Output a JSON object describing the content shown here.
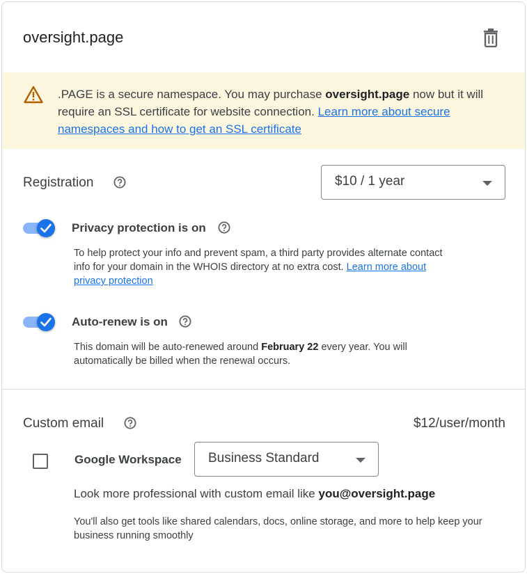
{
  "header": {
    "domain": "oversight.page",
    "delete_icon": "trash-icon"
  },
  "warning": {
    "icon": "warning-icon",
    "text_pre": ".PAGE is a secure namespace. You may purchase ",
    "domain_bold": "oversight.page",
    "text_post": " now but it will require an SSL certificate for website connection. ",
    "link": "Learn more about secure namespaces and how to get an SSL certificate"
  },
  "registration": {
    "title": "Registration",
    "help_icon": "help-icon",
    "select_value": "$10 / 1 year"
  },
  "privacy": {
    "state": "on",
    "label": "Privacy protection is on",
    "desc": "To help protect your info and prevent spam, a third party provides alternate contact info for your domain in the WHOIS directory at no extra cost. ",
    "link": "Learn more about privacy protection"
  },
  "autorenew": {
    "state": "on",
    "label": "Auto-renew is on",
    "desc_pre": "This domain will be auto-renewed around ",
    "date": "February 22",
    "desc_post": " every year. You will automatically be billed when the renewal occurs."
  },
  "custom_email": {
    "title": "Custom email",
    "help_icon": "help-icon",
    "price": "$12/user/month",
    "checkbox_checked": false,
    "workspace_label": "Google Workspace",
    "plan_value": "Business Standard",
    "promo_pre": "Look more professional with custom email like ",
    "promo_email": "you@oversight.page",
    "desc": "You'll also get tools like shared calendars, docs, online storage, and more to help keep your business running smoothly"
  },
  "colors": {
    "accent": "#1a73e8",
    "warning_bg": "#fef7e0",
    "warning_icon": "#b06000"
  }
}
